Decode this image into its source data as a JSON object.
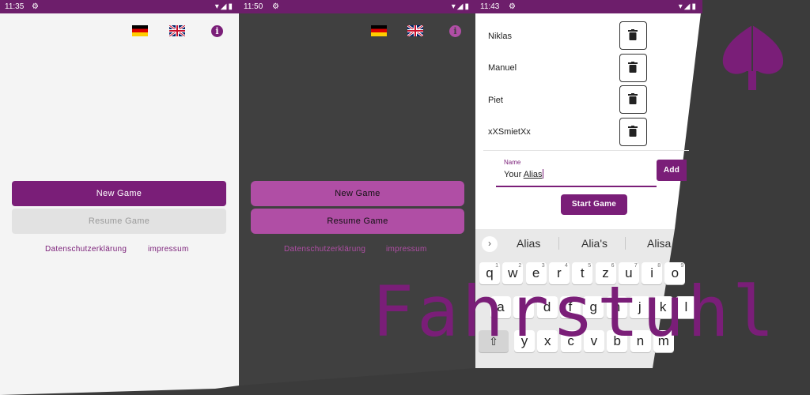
{
  "colors": {
    "primary": "#7a1e78",
    "light_primary": "#b04ea5",
    "link": "#7a1e78"
  },
  "screen1": {
    "status_time": "11:35",
    "new_game": "New Game",
    "resume_game": "Resume Game",
    "privacy": "Datenschutzerklärung",
    "imprint": "impressum"
  },
  "screen2": {
    "status_time": "11:50",
    "new_game": "New Game",
    "resume_game": "Resume Game",
    "privacy": "Datenschutzerklärung",
    "imprint": "impressum"
  },
  "screen3": {
    "status_time": "11:43",
    "players": [
      "Niklas",
      "Manuel",
      "Piet",
      "xXSmietXx"
    ],
    "name_label": "Name",
    "name_value_prefix": "Your ",
    "name_value_word": "Alias",
    "add": "Add",
    "start": "Start Game",
    "suggestions": [
      "Alias",
      "Alia's",
      "Alisa"
    ],
    "keys_row1": [
      "q",
      "w",
      "e",
      "r",
      "t",
      "z",
      "u",
      "i",
      "o"
    ],
    "keys_row1_digits": [
      "1",
      "2",
      "3",
      "4",
      "5",
      "6",
      "7",
      "8",
      "9"
    ],
    "keys_row2": [
      "a",
      "s",
      "d",
      "f",
      "g",
      "h",
      "j",
      "k",
      "l"
    ],
    "keys_row3": [
      "y",
      "x",
      "c",
      "v",
      "b",
      "n",
      "m"
    ]
  },
  "brand": {
    "title": "Fahrstuhl",
    "logo": "spade-tree-icon"
  }
}
